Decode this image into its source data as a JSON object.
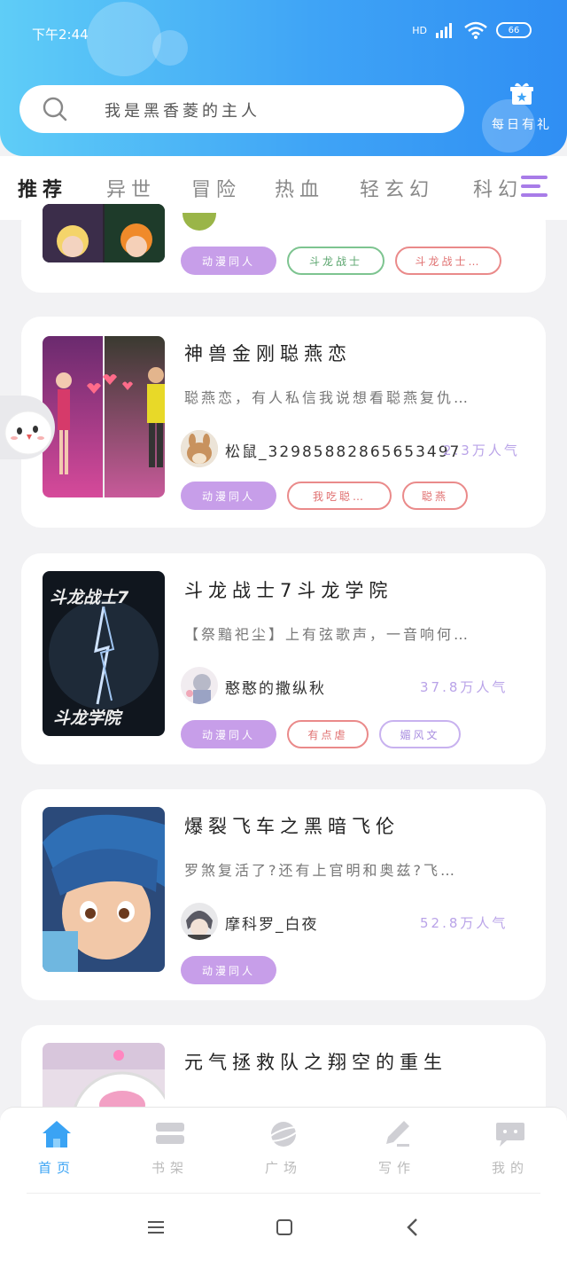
{
  "status": {
    "time": "下午2:44",
    "network": "HD",
    "battery": "66"
  },
  "search": {
    "placeholder": "我是黑香菱的主人"
  },
  "gift": {
    "label": "每日有礼"
  },
  "tabs": [
    "推荐",
    "异世",
    "冒险",
    "热血",
    "轻玄幻",
    "科幻"
  ],
  "active_tab": 0,
  "cards": [
    {
      "tags": [
        {
          "label": "动漫同人",
          "style": "fill"
        },
        {
          "label": "斗龙战士",
          "style": "green"
        },
        {
          "label": "斗龙战士…",
          "style": "red"
        }
      ]
    },
    {
      "title": "神兽金刚聪燕恋",
      "desc": "聪燕恋，有人私信我说想看聪燕复仇…",
      "author": "松鼠_32985882865653497",
      "popularity": "2.3万人气",
      "tags": [
        {
          "label": "动漫同人",
          "style": "fill"
        },
        {
          "label": "我吃聪…",
          "style": "red"
        },
        {
          "label": "聪燕",
          "style": "red"
        }
      ]
    },
    {
      "title": "斗龙战士7斗龙学院",
      "desc": "【祭黯祀尘】上有弦歌声，一音响何…",
      "author": "憨憨的撒纵秋",
      "popularity": "37.8万人气",
      "cover_text_top": "斗龙战士7",
      "cover_text_bottom": "斗龙学院",
      "tags": [
        {
          "label": "动漫同人",
          "style": "fill"
        },
        {
          "label": "有点虐",
          "style": "red"
        },
        {
          "label": "媚风文",
          "style": "purple"
        }
      ]
    },
    {
      "title": "爆裂飞车之黑暗飞伦",
      "desc": "罗煞复活了?还有上官明和奥兹?飞…",
      "author": "摩科罗_白夜",
      "popularity": "52.8万人气",
      "tags": [
        {
          "label": "动漫同人",
          "style": "fill"
        }
      ]
    },
    {
      "title": "元气拯救队之翔空的重生"
    }
  ],
  "bottom_nav": [
    {
      "label": "首页",
      "icon": "home-icon",
      "active": true
    },
    {
      "label": "书架",
      "icon": "bookshelf-icon",
      "active": false
    },
    {
      "label": "广场",
      "icon": "planet-icon",
      "active": false
    },
    {
      "label": "写作",
      "icon": "pen-icon",
      "active": false
    },
    {
      "label": "我的",
      "icon": "chat-bubble-icon",
      "active": false
    }
  ],
  "colors": {
    "accent": "#a87ce8",
    "header_start": "#5fcdf7",
    "header_end": "#2f8ef3",
    "nav_active": "#3aa3f4"
  }
}
